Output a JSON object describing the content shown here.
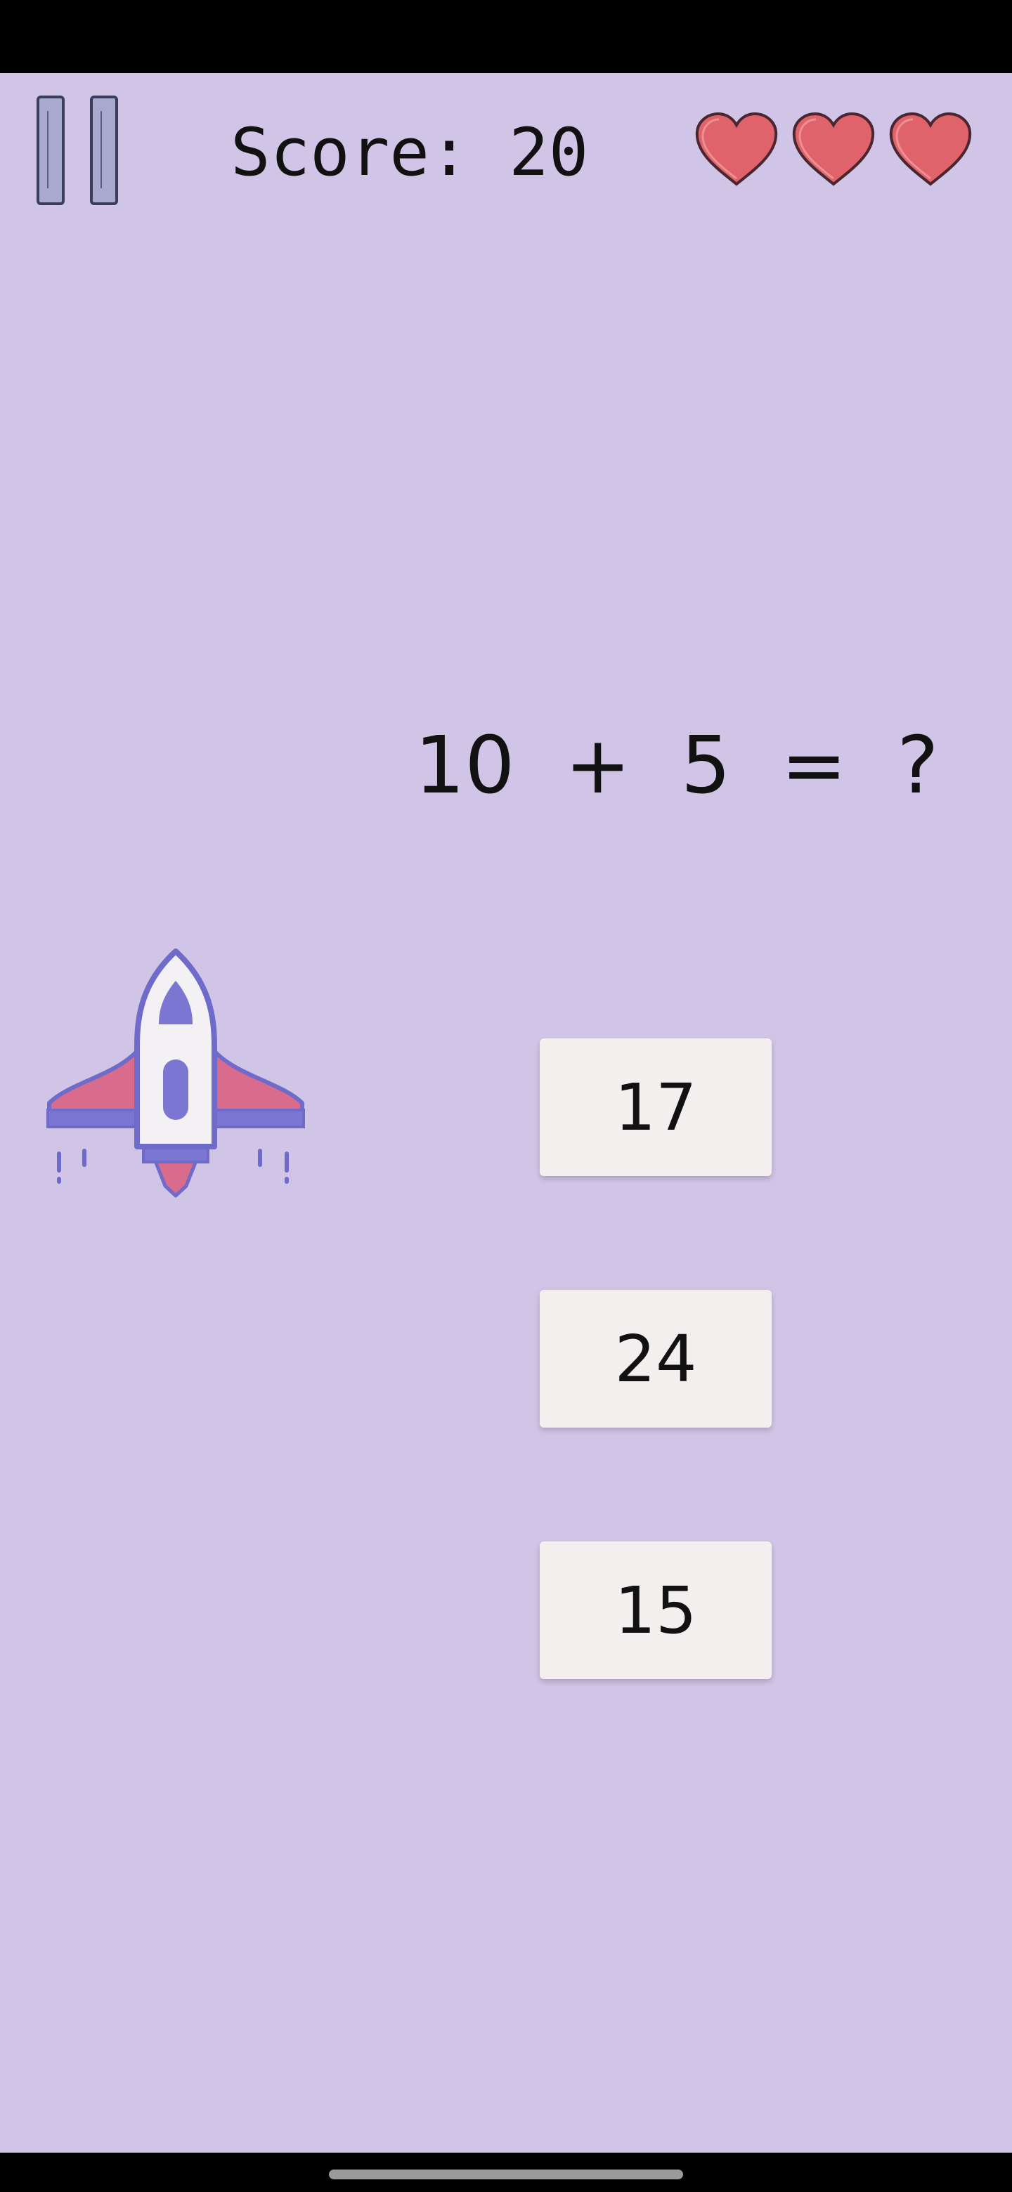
{
  "hud": {
    "score_label": "Score:",
    "score_value": "20",
    "lives": 3
  },
  "question": {
    "operand_a": "10",
    "operator": "+",
    "operand_b": "5",
    "equals": "=",
    "unknown": "?"
  },
  "answers": [
    {
      "label": "17"
    },
    {
      "label": "24"
    },
    {
      "label": "15"
    }
  ],
  "colors": {
    "background": "#d1c5e7",
    "heart_fill": "#e0636b",
    "rocket_accent": "#7b76d1",
    "rocket_wing": "#d96b8c",
    "answer_button": "#f3efef"
  },
  "icons": {
    "pause": "pause-icon",
    "heart": "heart-icon",
    "rocket": "rocket-icon"
  }
}
